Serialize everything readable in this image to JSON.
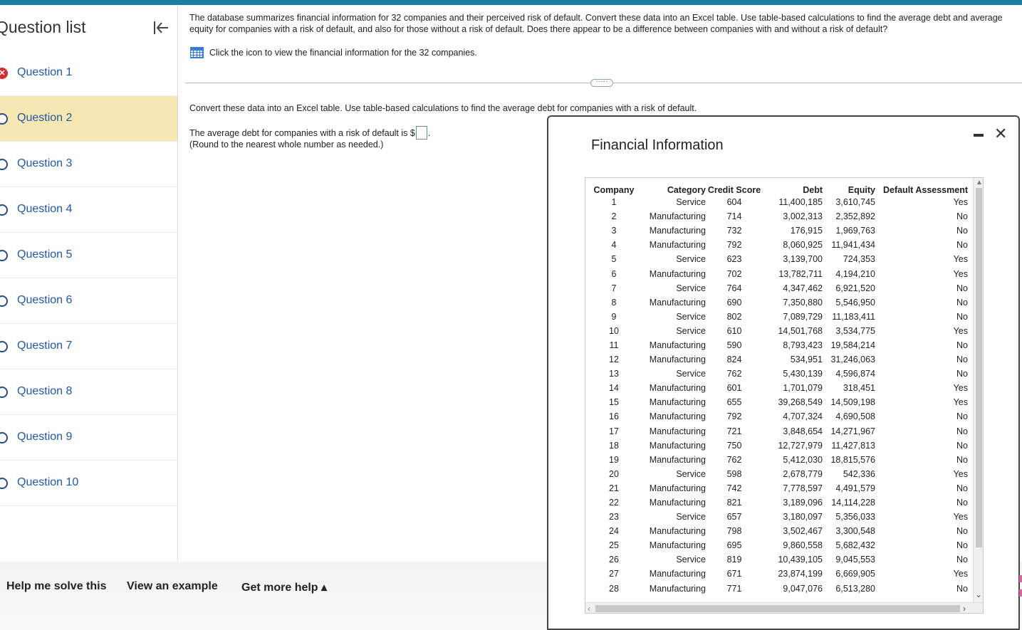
{
  "sidebar": {
    "title": "Question list",
    "questions": [
      {
        "label": "Question 1",
        "status": "incorrect"
      },
      {
        "label": "Question 2",
        "status": "current"
      },
      {
        "label": "Question 3",
        "status": "unanswered"
      },
      {
        "label": "Question 4",
        "status": "unanswered"
      },
      {
        "label": "Question 5",
        "status": "unanswered"
      },
      {
        "label": "Question 6",
        "status": "unanswered"
      },
      {
        "label": "Question 7",
        "status": "unanswered"
      },
      {
        "label": "Question 8",
        "status": "unanswered"
      },
      {
        "label": "Question 9",
        "status": "unanswered"
      },
      {
        "label": "Question 10",
        "status": "unanswered"
      }
    ]
  },
  "problem": {
    "text": "The database summarizes financial information for 32 companies and their perceived risk of default. Convert these data into an Excel table. Use table-based calculations to find the average debt and average equity for companies with a risk of default, and also for those without a risk of default. Does there appear to be a difference between companies with and without a risk of default?",
    "data_link": "Click the icon to view the financial information for the 32 companies.",
    "expander": "·····",
    "part_text": "Convert these data into an Excel table. Use table-based calculations to find the average debt for companies with a risk of default.",
    "answer_prefix": "The average debt for companies with a risk of default is $",
    "answer_suffix": ".",
    "round_note": "(Round to the nearest whole number as needed.)"
  },
  "help": {
    "solve": "Help me solve this",
    "example": "View an example",
    "more": "Get more help ▴"
  },
  "popup": {
    "title": "Financial Information",
    "columns": [
      "Company",
      "Category",
      "Credit Score",
      "Debt",
      "Equity",
      "Default Assessment"
    ],
    "rows": [
      [
        "1",
        "Service",
        "604",
        "11,400,185",
        "3,610,745",
        "Yes"
      ],
      [
        "2",
        "Manufacturing",
        "714",
        "3,002,313",
        "2,352,892",
        "No"
      ],
      [
        "3",
        "Manufacturing",
        "732",
        "176,915",
        "1,969,763",
        "No"
      ],
      [
        "4",
        "Manufacturing",
        "792",
        "8,060,925",
        "11,941,434",
        "No"
      ],
      [
        "5",
        "Service",
        "623",
        "3,139,700",
        "724,353",
        "Yes"
      ],
      [
        "6",
        "Manufacturing",
        "702",
        "13,782,711",
        "4,194,210",
        "Yes"
      ],
      [
        "7",
        "Service",
        "764",
        "4,347,462",
        "6,921,520",
        "No"
      ],
      [
        "8",
        "Manufacturing",
        "690",
        "7,350,880",
        "5,546,950",
        "No"
      ],
      [
        "9",
        "Service",
        "802",
        "7,089,729",
        "11,183,411",
        "No"
      ],
      [
        "10",
        "Service",
        "610",
        "14,501,768",
        "3,534,775",
        "Yes"
      ],
      [
        "11",
        "Manufacturing",
        "590",
        "8,793,423",
        "19,584,214",
        "No"
      ],
      [
        "12",
        "Manufacturing",
        "824",
        "534,951",
        "31,246,063",
        "No"
      ],
      [
        "13",
        "Service",
        "762",
        "5,430,139",
        "4,596,874",
        "No"
      ],
      [
        "14",
        "Manufacturing",
        "601",
        "1,701,079",
        "318,451",
        "Yes"
      ],
      [
        "15",
        "Manufacturing",
        "655",
        "39,268,549",
        "14,509,198",
        "Yes"
      ],
      [
        "16",
        "Manufacturing",
        "792",
        "4,707,324",
        "4,690,508",
        "No"
      ],
      [
        "17",
        "Manufacturing",
        "721",
        "3,848,654",
        "14,271,967",
        "No"
      ],
      [
        "18",
        "Manufacturing",
        "750",
        "12,727,979",
        "11,427,813",
        "No"
      ],
      [
        "19",
        "Manufacturing",
        "762",
        "5,412,030",
        "18,815,576",
        "No"
      ],
      [
        "20",
        "Service",
        "598",
        "2,678,779",
        "542,336",
        "Yes"
      ],
      [
        "21",
        "Manufacturing",
        "742",
        "7,778,597",
        "4,491,579",
        "No"
      ],
      [
        "22",
        "Manufacturing",
        "821",
        "3,189,096",
        "14,114,228",
        "No"
      ],
      [
        "23",
        "Service",
        "657",
        "3,180,097",
        "5,356,033",
        "Yes"
      ],
      [
        "24",
        "Manufacturing",
        "798",
        "3,502,467",
        "3,300,548",
        "No"
      ],
      [
        "25",
        "Manufacturing",
        "695",
        "9,860,558",
        "5,682,432",
        "No"
      ],
      [
        "26",
        "Service",
        "819",
        "10,439,105",
        "9,045,553",
        "No"
      ],
      [
        "27",
        "Manufacturing",
        "671",
        "23,874,199",
        "6,669,905",
        "Yes"
      ],
      [
        "28",
        "Manufacturing",
        "771",
        "9,047,076",
        "6,513,280",
        "No"
      ]
    ]
  },
  "colors": {
    "topbar": "#1a7fa3",
    "link": "#1f5aa8",
    "active_question": "#f6e7b3",
    "incorrect": "#d32f2f"
  }
}
